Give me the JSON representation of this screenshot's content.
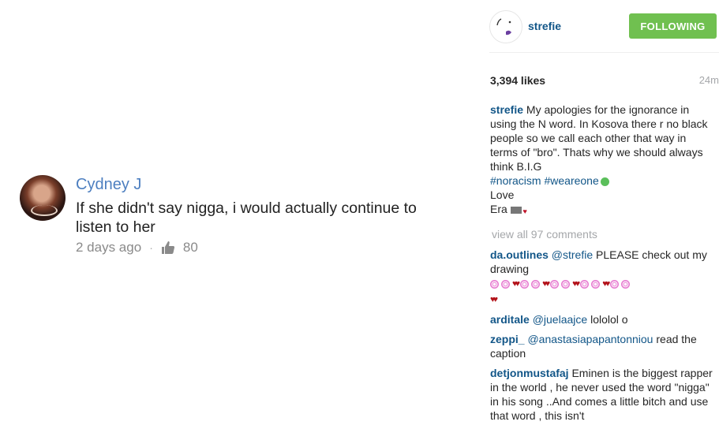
{
  "youtube_comment": {
    "author": "Cydney J",
    "text": "If she didn't say nigga, i would actually continue to listen to her",
    "time": "2 days ago",
    "separator": "·",
    "likes": "80"
  },
  "instagram": {
    "username": "strefie",
    "follow_label": "FOLLOWING",
    "likes": "3,394 likes",
    "time": "24m",
    "caption": {
      "author": "strefie",
      "text": "My apologies for the ignorance in using the N word. In Kosova there r no black people so we call each other that way in terms of \"bro\". Thats why we should always think B.I.G",
      "hashtags": "#noracism #weareone",
      "love": "Love",
      "signoff": "Era"
    },
    "view_all": "view all 97 comments",
    "comments": [
      {
        "author": "da.outlines",
        "mention": "@strefie",
        "text": "PLEASE check out my drawing"
      },
      {
        "author": "arditale",
        "mention": "@juelaajce",
        "text": "lololol o"
      },
      {
        "author": "zeppi_",
        "mention": "@anastasiapapantonniou",
        "text": "read the caption"
      },
      {
        "author": "detjonmustafaj",
        "mention": "",
        "text": "Eminen is the biggest rapper in the world , he never used the word \"nigga\" in his song ..And comes a little bitch and use that word , this isn't"
      }
    ],
    "colors": {
      "follow": "#70c050",
      "link": "#125688",
      "muted": "#a5a7aa"
    }
  }
}
